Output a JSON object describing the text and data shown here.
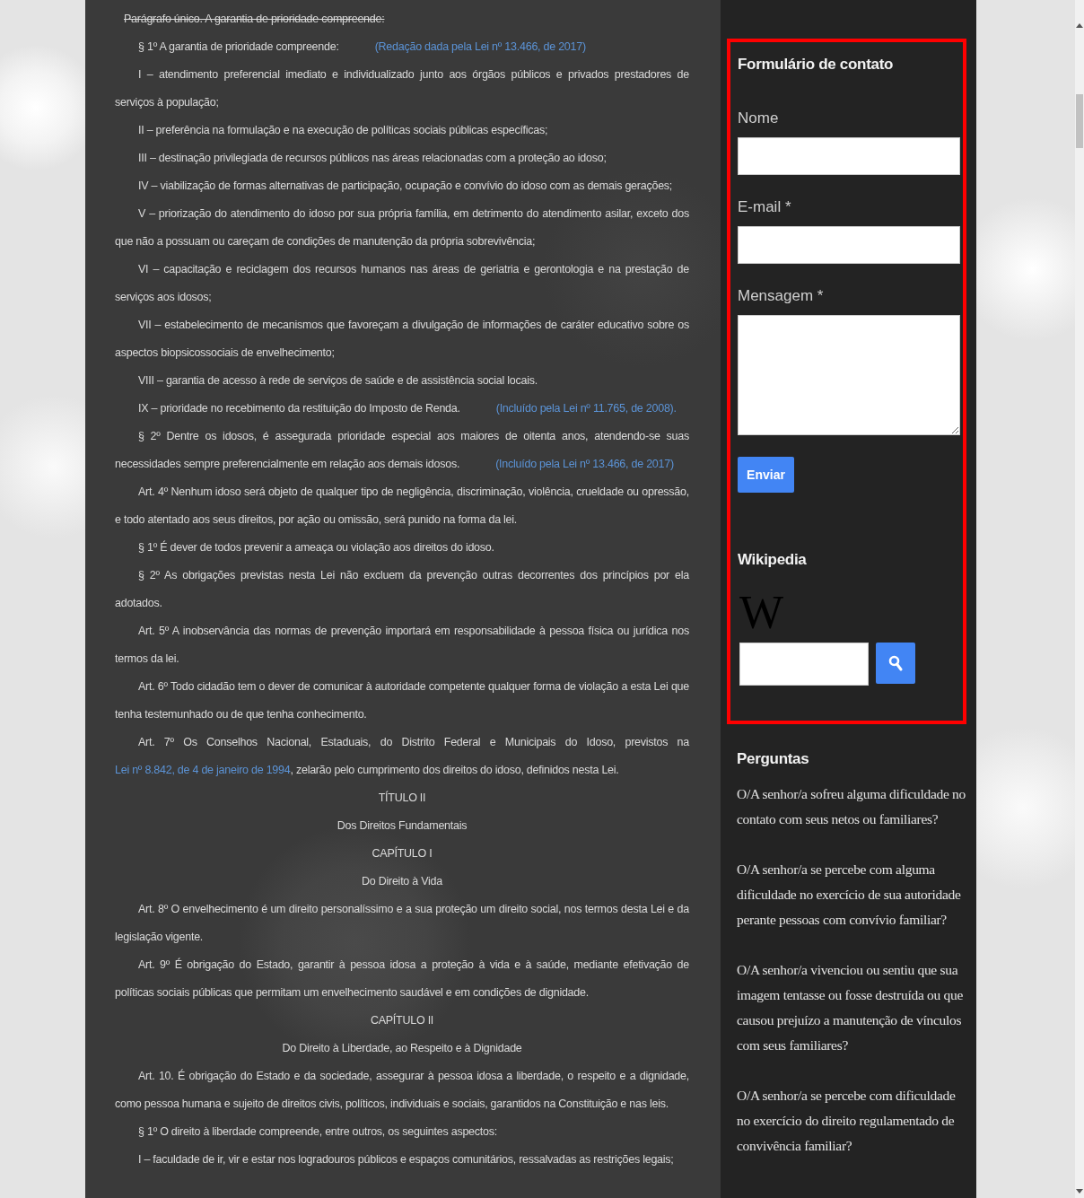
{
  "main": {
    "paragraphs": [
      {
        "kind": "struck",
        "parts": [
          {
            "kind": "text",
            "text": "Parágrafo único. A garantia de prioridade compreende:"
          }
        ]
      },
      {
        "kind": "para",
        "parts": [
          {
            "kind": "text",
            "text": "§ 1º A garantia de prioridade compreende:"
          },
          {
            "kind": "note",
            "text": "(Redação dada pela Lei nº 13.466, de 2017)"
          }
        ]
      },
      {
        "kind": "para",
        "parts": [
          {
            "kind": "text",
            "text": "I – atendimento preferencial imediato e individualizado junto aos órgãos públicos e privados prestadores de serviços à população;"
          }
        ]
      },
      {
        "kind": "para",
        "parts": [
          {
            "kind": "text",
            "text": "II – preferência na formulação e na execução de políticas sociais públicas específicas;"
          }
        ]
      },
      {
        "kind": "para",
        "parts": [
          {
            "kind": "text",
            "text": "III – destinação privilegiada de recursos públicos nas áreas relacionadas com a proteção ao idoso;"
          }
        ]
      },
      {
        "kind": "para",
        "parts": [
          {
            "kind": "text",
            "text": "IV – viabilização de formas alternativas de participação, ocupação e convívio do idoso com as demais gerações;"
          }
        ]
      },
      {
        "kind": "para",
        "parts": [
          {
            "kind": "text",
            "text": "V – priorização do atendimento do idoso por sua própria família, em detrimento do atendimento asilar, exceto dos que não a possuam ou careçam de condições de manutenção da própria sobrevivência;"
          }
        ]
      },
      {
        "kind": "para",
        "parts": [
          {
            "kind": "text",
            "text": "VI – capacitação e reciclagem dos recursos humanos nas áreas de geriatria e gerontologia e na prestação de serviços aos idosos;"
          }
        ]
      },
      {
        "kind": "para",
        "parts": [
          {
            "kind": "text",
            "text": "VII – estabelecimento de mecanismos que favoreçam a divulgação de informações de caráter educativo sobre os aspectos biopsicossociais de envelhecimento;"
          }
        ]
      },
      {
        "kind": "para",
        "parts": [
          {
            "kind": "text",
            "text": "VIII – garantia de acesso à rede de serviços de saúde e de assistência social locais."
          }
        ]
      },
      {
        "kind": "para",
        "parts": [
          {
            "kind": "text",
            "text": "IX – prioridade no recebimento da restituição do Imposto de Renda."
          },
          {
            "kind": "note",
            "text": "(Incluído pela Lei nº 11.765, de 2008)."
          }
        ]
      },
      {
        "kind": "para",
        "parts": [
          {
            "kind": "text",
            "text": "§ 2º  Dentre os idosos, é assegurada prioridade especial aos maiores de oitenta anos, atendendo-se suas necessidades sempre preferencialmente em relação aos demais idosos."
          },
          {
            "kind": "note",
            "text": "(Incluído pela Lei nº 13.466, de 2017)"
          }
        ]
      },
      {
        "kind": "para",
        "parts": [
          {
            "kind": "text",
            "text": "Art. 4º Nenhum idoso será objeto de qualquer tipo de negligência, discriminação, violência, crueldade ou opressão, e todo atentado aos seus direitos, por ação ou omissão, será punido na forma da lei."
          }
        ]
      },
      {
        "kind": "para",
        "parts": [
          {
            "kind": "text",
            "text": "§ 1º É dever de todos prevenir a ameaça ou violação aos direitos do idoso."
          }
        ]
      },
      {
        "kind": "para",
        "parts": [
          {
            "kind": "text",
            "text": "§ 2º As obrigações previstas nesta Lei não excluem da prevenção outras decorrentes dos princípios por ela adotados."
          }
        ]
      },
      {
        "kind": "para",
        "parts": [
          {
            "kind": "text",
            "text": "Art. 5º A inobservância das normas de prevenção importará em responsabilidade à pessoa física ou jurídica nos termos da lei."
          }
        ]
      },
      {
        "kind": "para",
        "parts": [
          {
            "kind": "text",
            "text": "Art. 6º Todo cidadão tem o dever de comunicar à autoridade competente qualquer forma de violação a esta Lei que tenha testemunhado ou de que tenha conhecimento."
          }
        ]
      },
      {
        "kind": "para",
        "parts": [
          {
            "kind": "text",
            "text": "Art. 7º Os Conselhos Nacional, Estaduais, do Distrito Federal e Municipais do Idoso, previstos na "
          },
          {
            "kind": "link",
            "text": "Lei nº 8.842, de 4 de janeiro de 1994"
          },
          {
            "kind": "text",
            "text": ", zelarão pelo cumprimento dos direitos do idoso, definidos nesta Lei."
          }
        ]
      },
      {
        "kind": "heading",
        "parts": [
          {
            "kind": "text",
            "text": "TÍTULO II"
          }
        ]
      },
      {
        "kind": "heading",
        "parts": [
          {
            "kind": "text",
            "text": "Dos Direitos Fundamentais"
          }
        ]
      },
      {
        "kind": "heading",
        "parts": [
          {
            "kind": "text",
            "text": "CAPÍTULO I"
          }
        ]
      },
      {
        "kind": "heading",
        "parts": [
          {
            "kind": "text",
            "text": "Do Direito à Vida"
          }
        ]
      },
      {
        "kind": "para",
        "parts": [
          {
            "kind": "text",
            "text": "Art. 8º O envelhecimento é um direito personalíssimo e a sua proteção um direito social, nos termos desta Lei e da legislação vigente."
          }
        ]
      },
      {
        "kind": "para",
        "parts": [
          {
            "kind": "text",
            "text": "Art. 9º É obrigação do Estado, garantir à pessoa idosa a proteção à vida e à saúde, mediante efetivação de políticas sociais públicas que permitam um envelhecimento saudável e em condições de dignidade."
          }
        ]
      },
      {
        "kind": "heading",
        "parts": [
          {
            "kind": "text",
            "text": "CAPÍTULO II"
          }
        ]
      },
      {
        "kind": "heading",
        "parts": [
          {
            "kind": "text",
            "text": "Do Direito à Liberdade, ao Respeito e à Dignidade"
          }
        ]
      },
      {
        "kind": "para",
        "parts": [
          {
            "kind": "text",
            "text": "Art. 10. É obrigação do Estado e da sociedade, assegurar à pessoa idosa a liberdade, o respeito e a dignidade, como pessoa humana e sujeito de direitos civis, políticos, individuais e sociais, garantidos na Constituição e nas leis."
          }
        ]
      },
      {
        "kind": "para",
        "parts": [
          {
            "kind": "text",
            "text": "§ 1º O direito à liberdade compreende, entre outros, os seguintes aspectos:"
          }
        ]
      },
      {
        "kind": "para",
        "parts": [
          {
            "kind": "text",
            "text": "I – faculdade de ir, vir e estar nos logradouros públicos e espaços comunitários, ressalvadas as restrições legais;"
          }
        ]
      }
    ]
  },
  "sidebar": {
    "contact_form": {
      "title": "Formulário de contato",
      "highlighted": true,
      "fields": [
        {
          "label": "Nome",
          "kind": "input"
        },
        {
          "label": "E-mail *",
          "kind": "input"
        },
        {
          "label": "Mensagem *",
          "kind": "textarea"
        }
      ],
      "submit": "Enviar"
    },
    "wikipedia": {
      "title": "Wikipedia",
      "logo": "W"
    },
    "questions": {
      "title": "Perguntas",
      "items": [
        "O/A senhor/a sofreu alguma dificuldade no contato com seus netos ou familiares?",
        "O/A senhor/a se percebe com alguma dificuldade no exercício de sua autoridade perante pessoas com convívio familiar?",
        "O/A senhor/a vivenciou ou sentiu que sua imagem tentasse ou fosse destruída ou que causou prejuízo a manutenção de vínculos com seus familiares?",
        "O/A senhor/a se percebe com dificuldade no exercício do direito regulamentado de convivência familiar?"
      ]
    }
  }
}
